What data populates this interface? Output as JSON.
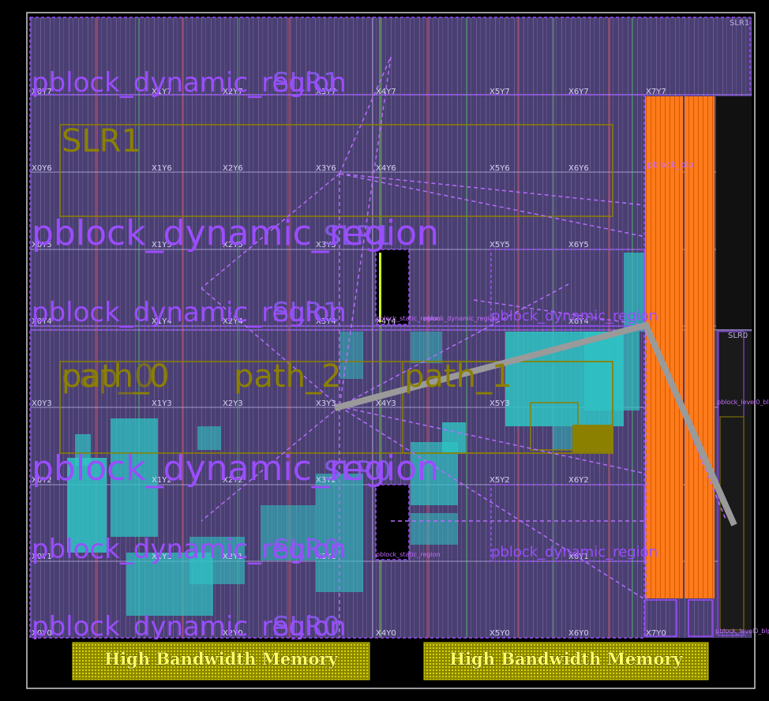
{
  "device_view": {
    "slr_labels": {
      "top": "SLR1",
      "bottom": "SLR0"
    },
    "clock_regions": {
      "row7": [
        "X0Y7",
        "X1Y7",
        "X2Y7",
        "X3Y7",
        "X4Y7",
        "X5Y7",
        "X6Y7",
        "X7Y7"
      ],
      "row6": [
        "X0Y6",
        "X1Y6",
        "X2Y6",
        "X3Y6",
        "X4Y6",
        "X5Y6",
        "X6Y6"
      ],
      "row5": [
        "X0Y5",
        "X1Y5",
        "X2Y5",
        "X3Y5",
        "X5Y5",
        "X6Y5"
      ],
      "row4": [
        "X0Y4",
        "X1Y4",
        "X2Y4",
        "X3Y4",
        "X4Y4",
        "X6Y4"
      ],
      "row3": [
        "X0Y3",
        "X1Y3",
        "X2Y3",
        "X3Y3",
        "X4Y3",
        "X5Y3"
      ],
      "row2": [
        "X0Y2",
        "X1Y2",
        "X2Y2",
        "X3Y2",
        "X5Y2",
        "X6Y2"
      ],
      "row1": [
        "X0Y1",
        "X1Y1",
        "X2Y1",
        "X3Y1",
        "X6Y1"
      ],
      "row0": [
        "X0Y0",
        "X2Y0",
        "X4Y0",
        "X5Y0",
        "X6Y0",
        "X7Y0"
      ]
    },
    "pblock_label": "pblock_dynamic_region",
    "slr_overlay_labels": {
      "row7": "SLR1",
      "row5": "SLR1",
      "row4": "SLR1",
      "row2": "SLR0",
      "row1": "SLR0",
      "row0": "SLR0"
    },
    "slr1_box_label": "SLR1",
    "path_labels": {
      "p0": "path_0",
      "p2": "path_2",
      "p1": "path_1",
      "ghost0": "cap_0"
    },
    "small_labels": {
      "blp": "pblock_blp",
      "static_region": "pblock_static_region",
      "dyn_small": "pblock_dynamic_region",
      "level0_blp": "pblock_level0_blp",
      "bottom_blp": "pblock_level0_blp"
    },
    "hbm_left": "High Bandwidth Memory",
    "hbm_right": "High Bandwidth Memory",
    "colors": {
      "background": "#000000",
      "fabric": "#4a3f72",
      "pblock": "#9b4dff",
      "path_box": "#8b8000",
      "orange": "#ff7a1a",
      "cyan": "#2ec4c4",
      "net_line": "#9a9a9a",
      "hbm_fill": "#c8c400",
      "hbm_text": "#ffff66"
    }
  }
}
